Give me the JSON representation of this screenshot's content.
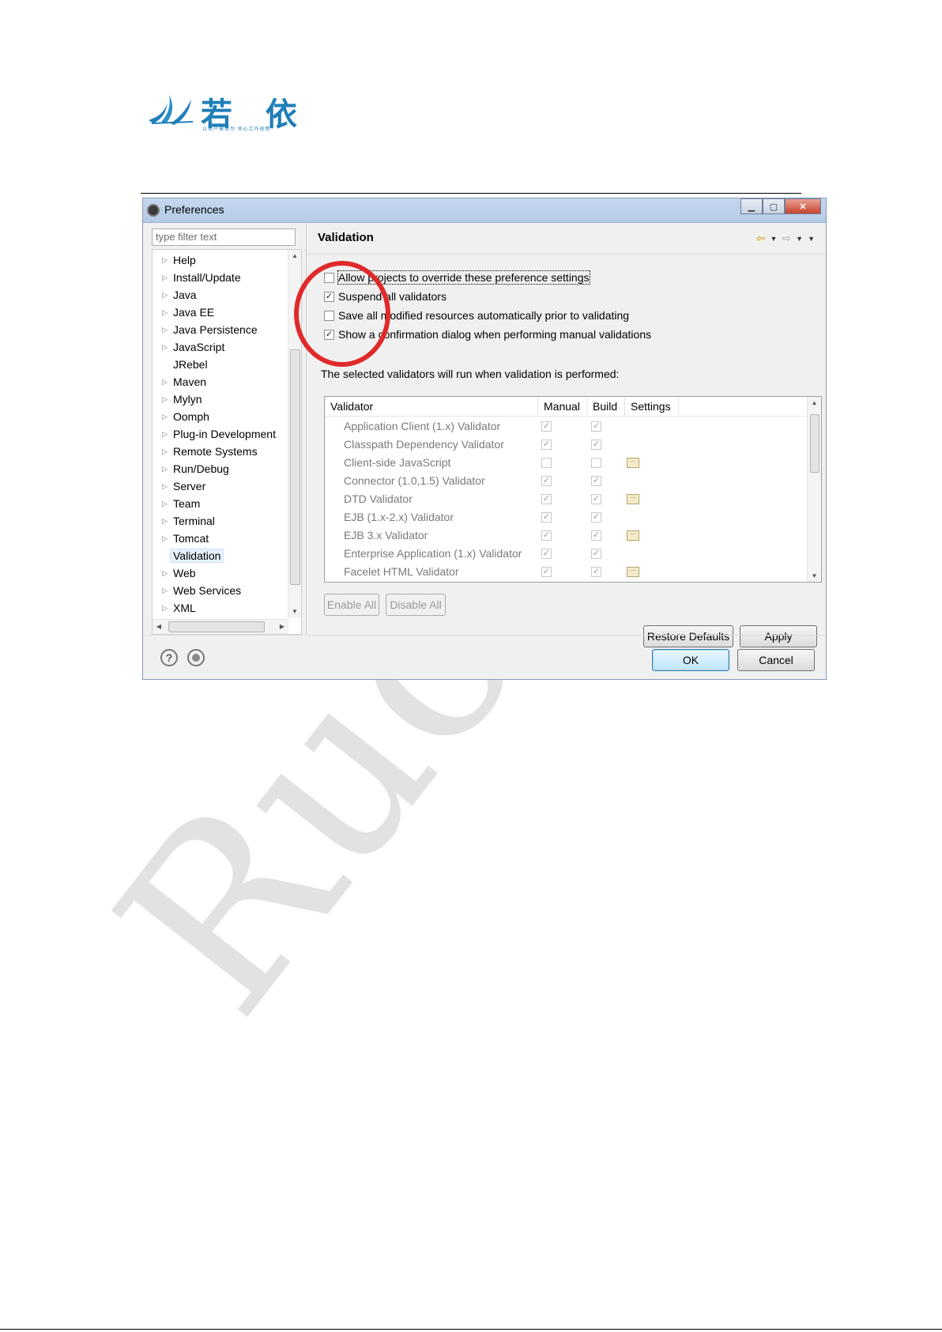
{
  "logo": {
    "text": "若 依",
    "tagline": "以用户需求为 关心工作创新"
  },
  "watermark": "RuoYi",
  "dialog": {
    "title": "Preferences",
    "filter_placeholder": "type filter text",
    "tree_items": [
      {
        "label": "Help",
        "expandable": true
      },
      {
        "label": "Install/Update",
        "expandable": true
      },
      {
        "label": "Java",
        "expandable": true
      },
      {
        "label": "Java EE",
        "expandable": true
      },
      {
        "label": "Java Persistence",
        "expandable": true
      },
      {
        "label": "JavaScript",
        "expandable": true
      },
      {
        "label": "JRebel",
        "expandable": false
      },
      {
        "label": "Maven",
        "expandable": true
      },
      {
        "label": "Mylyn",
        "expandable": true
      },
      {
        "label": "Oomph",
        "expandable": true
      },
      {
        "label": "Plug-in Development",
        "expandable": true
      },
      {
        "label": "Remote Systems",
        "expandable": true
      },
      {
        "label": "Run/Debug",
        "expandable": true
      },
      {
        "label": "Server",
        "expandable": true
      },
      {
        "label": "Team",
        "expandable": true
      },
      {
        "label": "Terminal",
        "expandable": true
      },
      {
        "label": "Tomcat",
        "expandable": true
      },
      {
        "label": "Validation",
        "expandable": false,
        "selected": true
      },
      {
        "label": "Web",
        "expandable": true
      },
      {
        "label": "Web Services",
        "expandable": true
      },
      {
        "label": "XML",
        "expandable": true
      }
    ],
    "page_title": "Validation",
    "options": [
      {
        "label": "Allow projects to override these preference settings",
        "checked": false
      },
      {
        "label": "Suspend all validators",
        "checked": true
      },
      {
        "label": "Save all modified resources automatically prior to validating",
        "checked": false
      },
      {
        "label": "Show a confirmation dialog when performing manual validations",
        "checked": true
      }
    ],
    "validators_intro": "The selected validators will run when validation is performed:",
    "table_headers": [
      "Validator",
      "Manual",
      "Build",
      "Settings"
    ],
    "validators": [
      {
        "name": "Application Client (1.x) Validator",
        "manual": true,
        "build": true,
        "settings": false
      },
      {
        "name": "Classpath Dependency Validator",
        "manual": true,
        "build": true,
        "settings": false
      },
      {
        "name": "Client-side JavaScript",
        "manual": false,
        "build": false,
        "settings": true
      },
      {
        "name": "Connector (1.0,1.5) Validator",
        "manual": true,
        "build": true,
        "settings": false
      },
      {
        "name": "DTD Validator",
        "manual": true,
        "build": true,
        "settings": true
      },
      {
        "name": "EJB (1.x-2.x) Validator",
        "manual": true,
        "build": true,
        "settings": false
      },
      {
        "name": "EJB 3.x Validator",
        "manual": true,
        "build": true,
        "settings": true
      },
      {
        "name": "Enterprise Application (1.x) Validator",
        "manual": true,
        "build": true,
        "settings": false
      },
      {
        "name": "Facelet HTML Validator",
        "manual": true,
        "build": true,
        "settings": true
      }
    ],
    "settings_glyph": "···",
    "buttons": {
      "enable_all": "Enable All",
      "disable_all": "Disable All",
      "restore_defaults": "Restore Defaults",
      "apply": "Apply",
      "ok": "OK",
      "cancel": "Cancel"
    },
    "icons": {
      "help": "help-icon",
      "record": "record-icon",
      "back": "back-arrow-icon",
      "forward": "forward-arrow-icon"
    }
  }
}
